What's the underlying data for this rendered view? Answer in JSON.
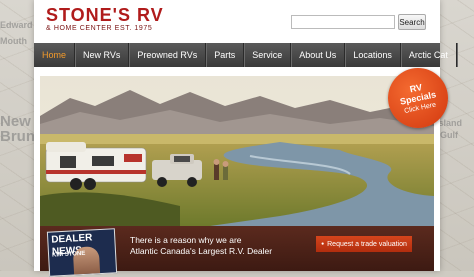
{
  "background_map": {
    "labels": [
      "New",
      "Brunswick",
      "Edward",
      "Mouth",
      "Island",
      "Gulf"
    ]
  },
  "header": {
    "logo_main": "STONE'S RV",
    "logo_sub": "& HOME CENTER EST. 1975",
    "search_placeholder": "",
    "search_button": "Search"
  },
  "nav": {
    "items": [
      "Home",
      "New RVs",
      "Preowned RVs",
      "Parts",
      "Service",
      "About Us",
      "Locations",
      "Arctic Cat"
    ],
    "active": "Home"
  },
  "badge": {
    "line1": "RV",
    "line2": "Specials",
    "line3": "Click Here"
  },
  "promo": {
    "dealer_news_title": "DEALER NEWS",
    "dealer_news_name": "KIM STONE",
    "tagline_line1": "There is a reason why we are",
    "tagline_line2": "Atlantic Canada's Largest R.V. Dealer",
    "trade_button": "Request a trade valuation"
  },
  "colors": {
    "brand_red": "#b01b1b",
    "nav_active": "#f39a2a",
    "badge_orange": "#e14a1c",
    "bottom_bar": "#4a2016"
  }
}
